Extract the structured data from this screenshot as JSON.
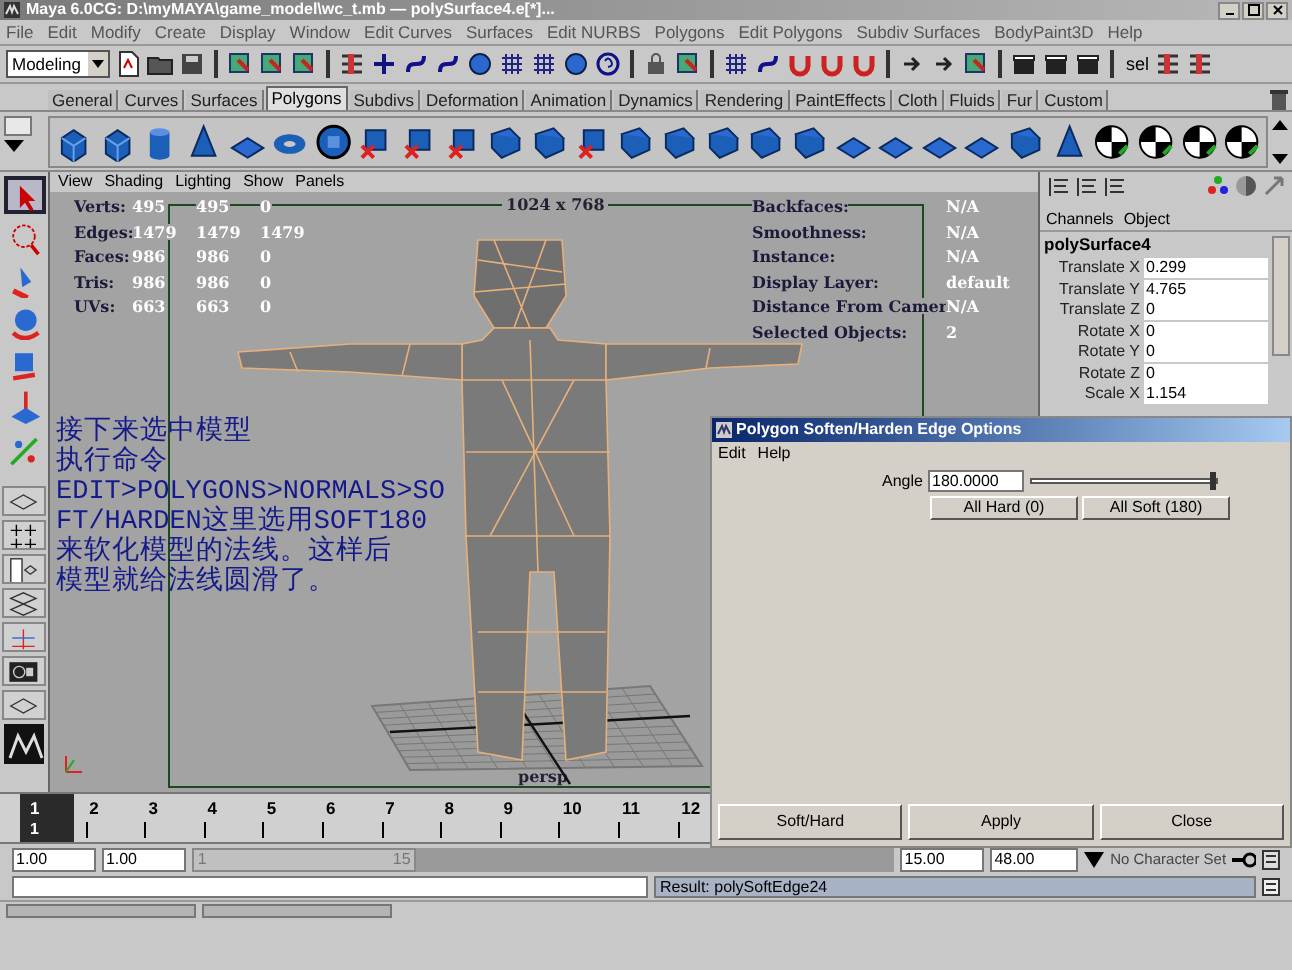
{
  "window": {
    "title": "Maya 6.0CG: D:\\myMAYA\\game_model\\wc_t.mb  —  polySurface4.e[*]..."
  },
  "menu_bar": [
    "File",
    "Edit",
    "Modify",
    "Create",
    "Display",
    "Window",
    "Edit Curves",
    "Surfaces",
    "Edit NURBS",
    "Polygons",
    "Edit Polygons",
    "Subdiv Surfaces",
    "BodyPaint3D",
    "Help"
  ],
  "status_line": {
    "mode": "Modeling",
    "selection_label": "sel"
  },
  "shelf": {
    "tabs": [
      {
        "label": "General",
        "selected": false
      },
      {
        "label": "Curves",
        "selected": false
      },
      {
        "label": "Surfaces",
        "selected": false
      },
      {
        "label": "Polygons",
        "selected": true
      },
      {
        "label": "Subdivs",
        "selected": false
      },
      {
        "label": "Deformation",
        "selected": false
      },
      {
        "label": "Animation",
        "selected": false
      },
      {
        "label": "Dynamics",
        "selected": false
      },
      {
        "label": "Rendering",
        "selected": false
      },
      {
        "label": "PaintEffects",
        "selected": false
      },
      {
        "label": "Cloth",
        "selected": false
      },
      {
        "label": "Fluids",
        "selected": false
      },
      {
        "label": "Fur",
        "selected": false
      },
      {
        "label": "Custom",
        "selected": false
      }
    ]
  },
  "viewport": {
    "menu": [
      "View",
      "Shading",
      "Lighting",
      "Show",
      "Panels"
    ],
    "hud_left": [
      {
        "label": "Verts:",
        "values": [
          "495",
          "495",
          "0"
        ]
      },
      {
        "label": "Edges:",
        "values": [
          "1479",
          "1479",
          "1479"
        ]
      },
      {
        "label": "Faces:",
        "values": [
          "986",
          "986",
          "0"
        ]
      },
      {
        "label": "Tris:",
        "values": [
          "986",
          "986",
          "0"
        ]
      },
      {
        "label": "UVs:",
        "values": [
          "663",
          "663",
          "0"
        ]
      }
    ],
    "hud_right": [
      {
        "label": "Backfaces:",
        "value": "N/A"
      },
      {
        "label": "Smoothness:",
        "value": "N/A"
      },
      {
        "label": "Instance:",
        "value": "N/A"
      },
      {
        "label": "Display Layer:",
        "value": "default"
      },
      {
        "label": "Distance From Camer",
        "value": "N/A"
      },
      {
        "label": "Selected Objects:",
        "value": "2"
      }
    ],
    "resolution": "1024 x 768",
    "camera": "persp",
    "annotation": [
      "接下来选中模型",
      "执行命令",
      "EDIT>POLYGONS>NORMALS>SO",
      "FT/HARDEN这里选用SOFT180",
      "来软化模型的法线。这样后",
      "模型就给法线圆滑了。"
    ]
  },
  "channel_box": {
    "menu": [
      "Channels",
      "Object"
    ],
    "object": "polySurface4",
    "channels": [
      {
        "name": "Translate X",
        "value": "0.299"
      },
      {
        "name": "Translate Y",
        "value": "4.765"
      },
      {
        "name": "Translate Z",
        "value": "0"
      },
      {
        "name": "Rotate X",
        "value": "0"
      },
      {
        "name": "Rotate Y",
        "value": "0"
      },
      {
        "name": "Rotate Z",
        "value": "0"
      },
      {
        "name": "Scale X",
        "value": "1.154"
      }
    ]
  },
  "dialog": {
    "title": "Polygon Soften/Harden Edge Options",
    "menu": [
      "Edit",
      "Help"
    ],
    "angle": {
      "label": "Angle",
      "value": "180.0000",
      "level": 1
    },
    "preset_buttons": [
      "All Hard (0)",
      "All Soft (180)"
    ],
    "buttons": [
      "Soft/Hard",
      "Apply",
      "Close"
    ]
  },
  "time_slider": {
    "frames": [
      {
        "label": "1",
        "selected": true
      },
      {
        "label": "2",
        "selected": false
      },
      {
        "label": "3",
        "selected": false
      },
      {
        "label": "4",
        "selected": false
      },
      {
        "label": "5",
        "selected": false
      },
      {
        "label": "6",
        "selected": false
      },
      {
        "label": "7",
        "selected": false
      },
      {
        "label": "8",
        "selected": false
      },
      {
        "label": "9",
        "selected": false
      },
      {
        "label": "10",
        "selected": false
      },
      {
        "label": "11",
        "selected": false
      },
      {
        "label": "12",
        "selected": false
      }
    ],
    "current_frame": "1"
  },
  "range_slider": {
    "level": 0.32,
    "start": "1.00",
    "range_start": "1.00",
    "handle_start": "1",
    "handle_end": "15",
    "range_end": "15.00",
    "end": "48.00",
    "character_set": "No Character Set"
  },
  "command_line": {
    "result": "Result: polySoftEdge24"
  }
}
